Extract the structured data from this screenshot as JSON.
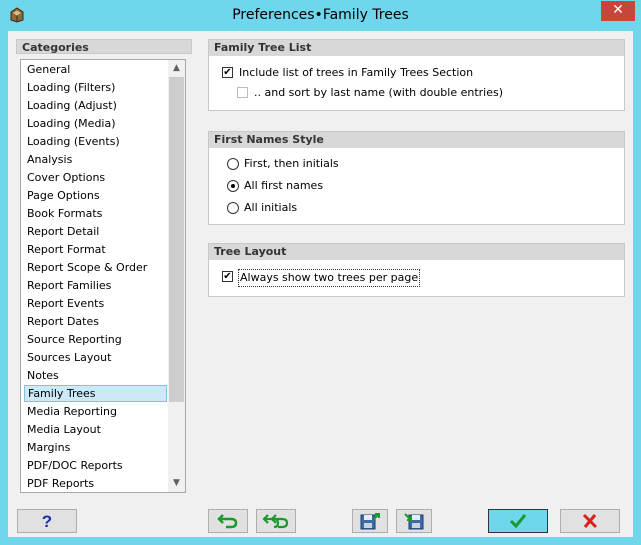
{
  "window": {
    "title": "Preferences•Family Trees",
    "close_glyph": "✕"
  },
  "categories": {
    "header": "Categories",
    "items": [
      "General",
      "Loading (Filters)",
      "Loading (Adjust)",
      "Loading (Media)",
      "Loading (Events)",
      "Analysis",
      "Cover Options",
      "Page Options",
      "Book Formats",
      "Report Detail",
      "Report Format",
      "Report Scope & Order",
      "Report Families",
      "Report Events",
      "Report Dates",
      "Source Reporting",
      "Sources Layout",
      "Notes",
      "Family Trees",
      "Media Reporting",
      "Media Layout",
      "Margins",
      "PDF/DOC Reports",
      "PDF Reports"
    ],
    "selected": "Family Trees"
  },
  "family_tree_list": {
    "header": "Family Tree List",
    "include_label": "Include list of trees in Family Trees Section",
    "include_checked": true,
    "sort_label": ".. and sort by last name (with double entries)",
    "sort_checked": false
  },
  "first_names_style": {
    "header": "First Names Style",
    "options": [
      "First, then initials",
      "All first names",
      "All initials"
    ],
    "selected": "All first names"
  },
  "tree_layout": {
    "header": "Tree Layout",
    "two_trees_label": "Always show two trees per page",
    "two_trees_checked": true
  },
  "buttons": {
    "help": "?",
    "undo": "undo-icon",
    "undo_all": "undo-all-icon",
    "save": "save-icon",
    "load": "load-icon",
    "ok": "checkmark-icon",
    "cancel": "cancel-x-icon"
  },
  "colors": {
    "accent": "#6fd6ec",
    "ok_check": "#1a9a2a",
    "cancel_x": "#d8201c",
    "help_q": "#1a2fa8",
    "arrow_green": "#1a9a2a"
  }
}
